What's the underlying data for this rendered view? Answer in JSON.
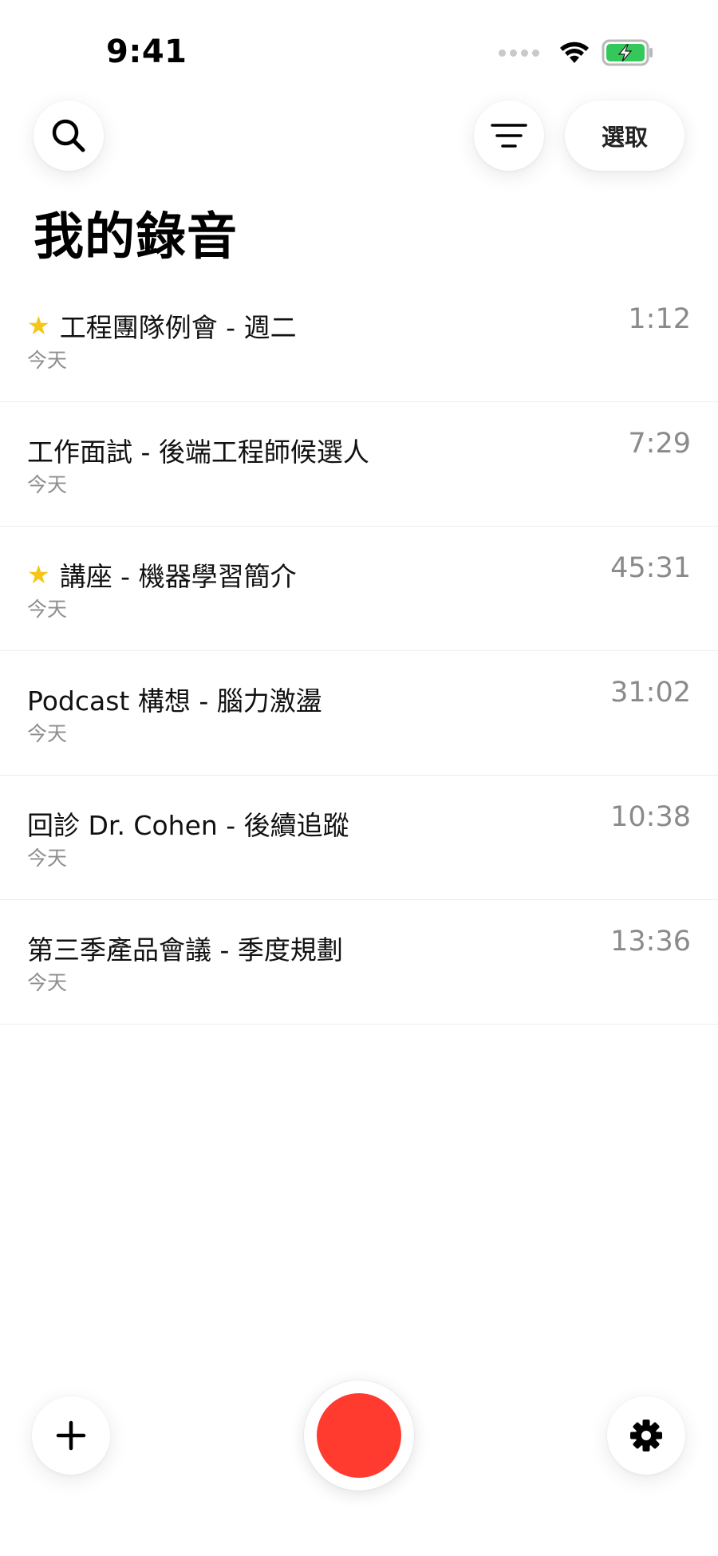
{
  "status_bar": {
    "time": "9:41"
  },
  "header": {
    "select_label": "選取",
    "title": "我的錄音"
  },
  "recordings": [
    {
      "title": "工程團隊例會 - 週二",
      "date": "今天",
      "duration": "1:12",
      "starred": true
    },
    {
      "title": "工作面試 - 後端工程師候選人",
      "date": "今天",
      "duration": "7:29",
      "starred": false
    },
    {
      "title": "講座 - 機器學習簡介",
      "date": "今天",
      "duration": "45:31",
      "starred": true
    },
    {
      "title": "Podcast 構想 - 腦力激盪",
      "date": "今天",
      "duration": "31:02",
      "starred": false
    },
    {
      "title": "回診 Dr. Cohen - 後續追蹤",
      "date": "今天",
      "duration": "10:38",
      "starred": false
    },
    {
      "title": "第三季產品會議 - 季度規劃",
      "date": "今天",
      "duration": "13:36",
      "starred": false
    }
  ],
  "icons": {
    "search": "search-icon",
    "filter": "filter-icon",
    "add": "plus-icon",
    "settings": "gear-icon",
    "record": "record-icon",
    "star": "star-icon"
  },
  "colors": {
    "record": "#ff3b30",
    "star": "#f5c518",
    "battery": "#34c759"
  }
}
